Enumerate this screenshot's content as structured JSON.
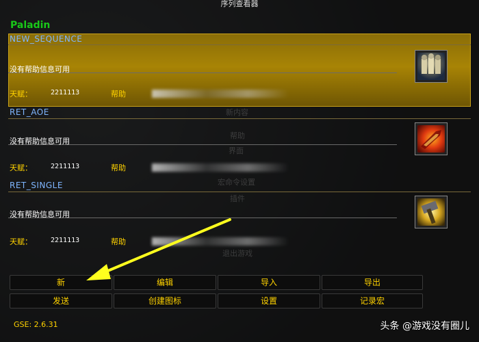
{
  "window": {
    "title": "序列查看器"
  },
  "addon": {
    "name": "Paladin"
  },
  "sequences": [
    {
      "name": "NEW_SEQUENCE",
      "description": "没有帮助信息可用",
      "talent_label": "天赋：",
      "talent_value": "2211113",
      "help_label": "帮助",
      "icon": "paladin-units-icon",
      "selected": true
    },
    {
      "name": "RET_AOE",
      "description": "没有帮助信息可用",
      "talent_label": "天赋：",
      "talent_value": "2211113",
      "help_label": "帮助",
      "icon": "fiery-blade-icon",
      "selected": false
    },
    {
      "name": "RET_SINGLE",
      "description": "没有帮助信息可用",
      "talent_label": "天赋：",
      "talent_value": "2211113",
      "help_label": "帮助",
      "icon": "golden-hammer-icon",
      "selected": false
    }
  ],
  "buttons": {
    "new": "新",
    "edit": "编辑",
    "import": "导入",
    "export": "导出",
    "send": "发送",
    "create_icon": "创建图标",
    "settings": "设置",
    "record_macro": "记录宏"
  },
  "version": "GSE: 2.6.31",
  "watermark": "头条 @游戏没有圈儿",
  "colors": {
    "selected_row": "#a88405",
    "accent_text": "#ffd200",
    "sequence_name": "#7fb6ff",
    "addon_name": "#19c819",
    "arrow": "#ffff1e"
  }
}
